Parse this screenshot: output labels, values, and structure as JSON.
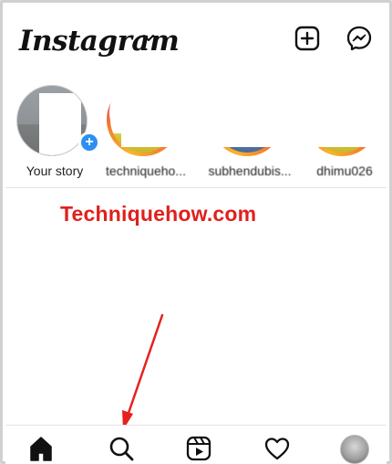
{
  "header": {
    "logo_text": "Instagram",
    "icons": [
      "chevron-down-icon",
      "new-post-icon",
      "messenger-icon"
    ]
  },
  "stories": [
    {
      "name": "Your story",
      "type": "own"
    },
    {
      "name": "techniqueho...",
      "type": "ring"
    },
    {
      "name": "subhendubis...",
      "type": "ring"
    },
    {
      "name": "dhimu026",
      "type": "ring"
    }
  ],
  "watermark": "Techniquehow.com",
  "tabbar": {
    "items": [
      "home-icon",
      "search-icon",
      "reels-icon",
      "heart-icon",
      "profile-avatar"
    ]
  },
  "colors": {
    "watermark": "#e0201c",
    "add_story_badge": "#2d8ff0",
    "arrow": "#e8201c"
  }
}
